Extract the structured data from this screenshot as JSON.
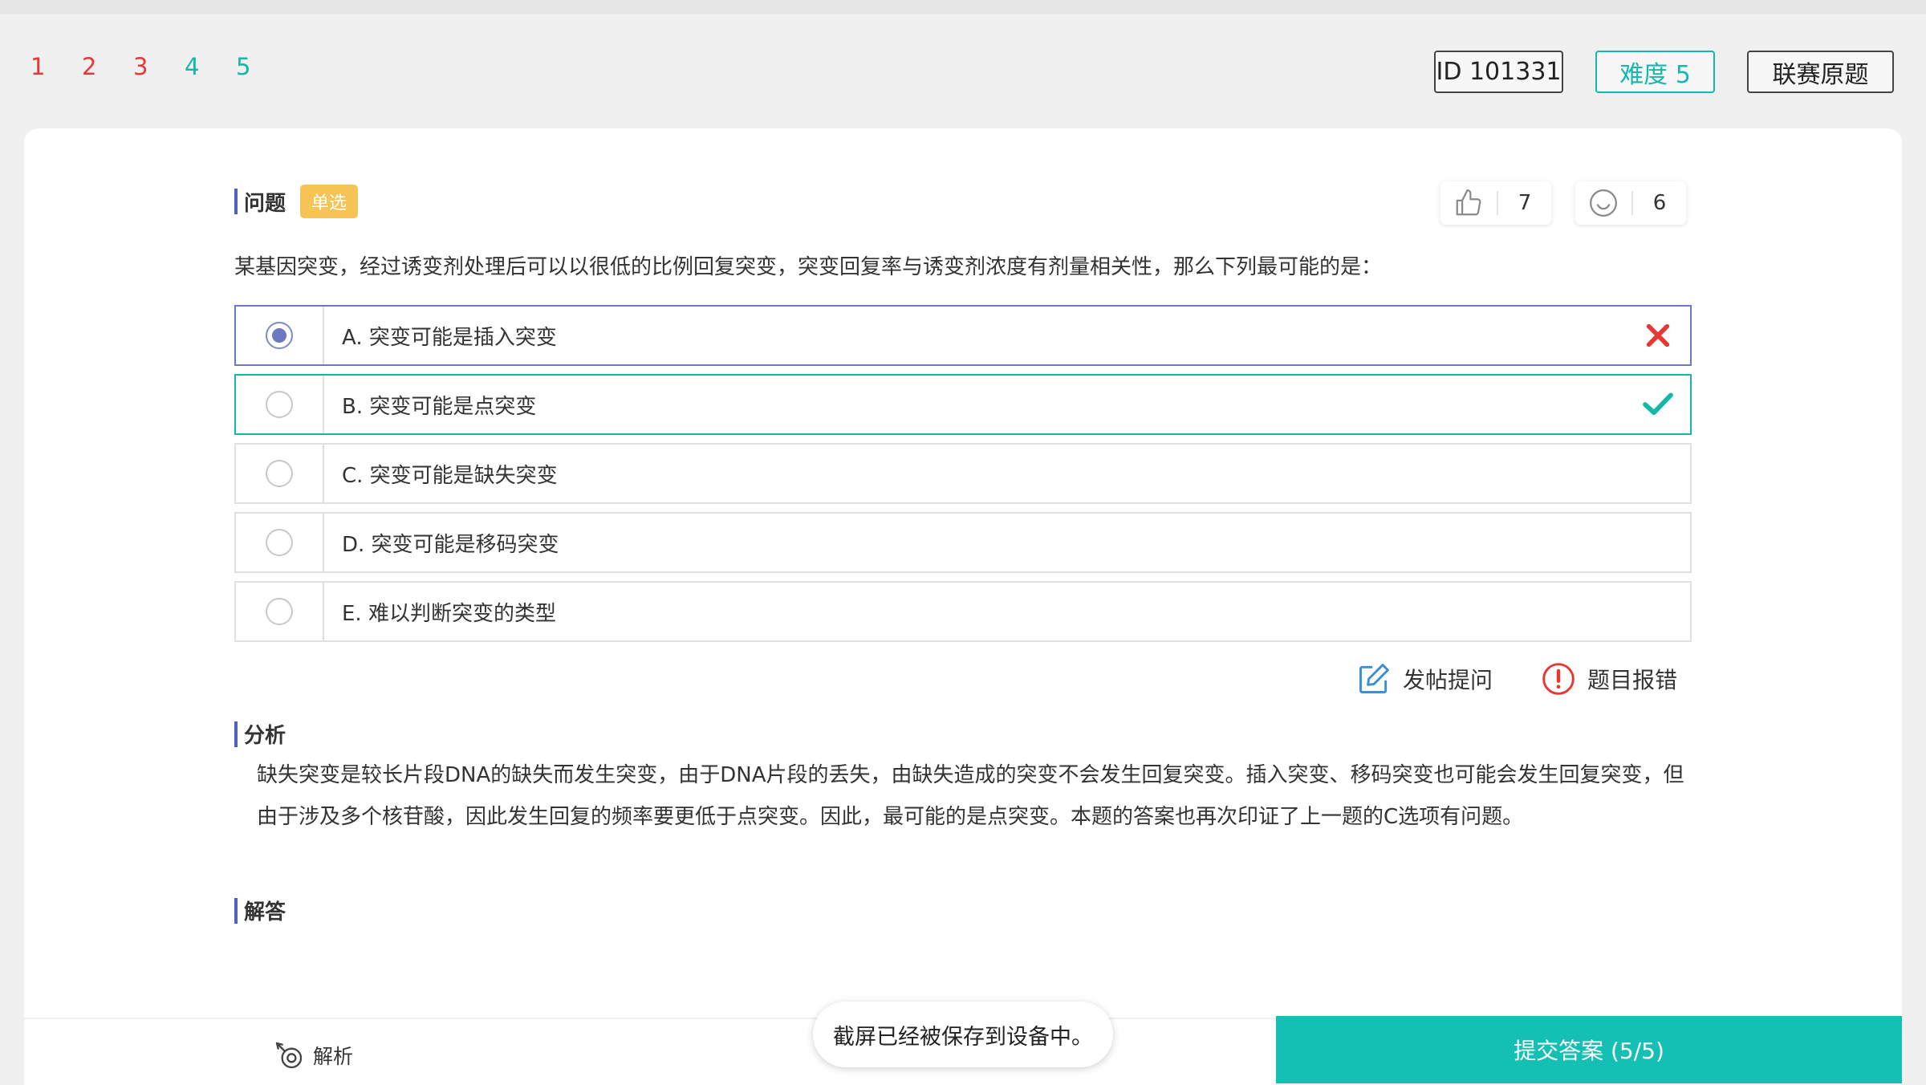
{
  "nav": {
    "questions": [
      {
        "label": "1",
        "state": "wrong"
      },
      {
        "label": "2",
        "state": "wrong"
      },
      {
        "label": "3",
        "state": "wrong",
        "current": true
      },
      {
        "label": "4",
        "state": "right"
      },
      {
        "label": "5",
        "state": "right"
      }
    ]
  },
  "tags": {
    "id": "ID 101331",
    "difficulty": "难度 5",
    "original": "联赛原题"
  },
  "question": {
    "title": "问题",
    "type_badge": "单选",
    "likes": "7",
    "smiles": "6",
    "text": "某基因突变，经过诱变剂处理后可以以很低的比例回复突变，突变回复率与诱变剂浓度有剂量相关性，那么下列最可能的是：",
    "options": [
      {
        "label": "A. 突变可能是插入突变",
        "selected": true,
        "result": "wrong"
      },
      {
        "label": "B. 突变可能是点突变",
        "selected": false,
        "result": "correct"
      },
      {
        "label": "C. 突变可能是缺失突变",
        "selected": false,
        "result": ""
      },
      {
        "label": "D. 突变可能是移码突变",
        "selected": false,
        "result": ""
      },
      {
        "label": "E. 难以判断突变的类型",
        "selected": false,
        "result": ""
      }
    ]
  },
  "actions": {
    "post": "发帖提问",
    "report": "题目报错"
  },
  "analysis": {
    "title": "分析",
    "text": "缺失突变是较长片段DNA的缺失而发生突变，由于DNA片段的丢失，由缺失造成的突变不会发生回复突变。插入突变、移码突变也可能会发生回复突变，但由于涉及多个核苷酸，因此发生回复的频率要更低于点突变。因此，最可能的是点突变。本题的答案也再次印证了上一题的C选项有问题。"
  },
  "answer": {
    "title": "解答"
  },
  "bottom": {
    "analysis_label": "解析",
    "submit_label": "提交答案 (5/5)"
  },
  "toast": "截屏已经被保存到设备中。",
  "colors": {
    "wrong": "#e53935",
    "correct": "#14b8a6",
    "accent": "#14bfb4",
    "selected": "#6c79c2",
    "badge": "#f6c355"
  }
}
